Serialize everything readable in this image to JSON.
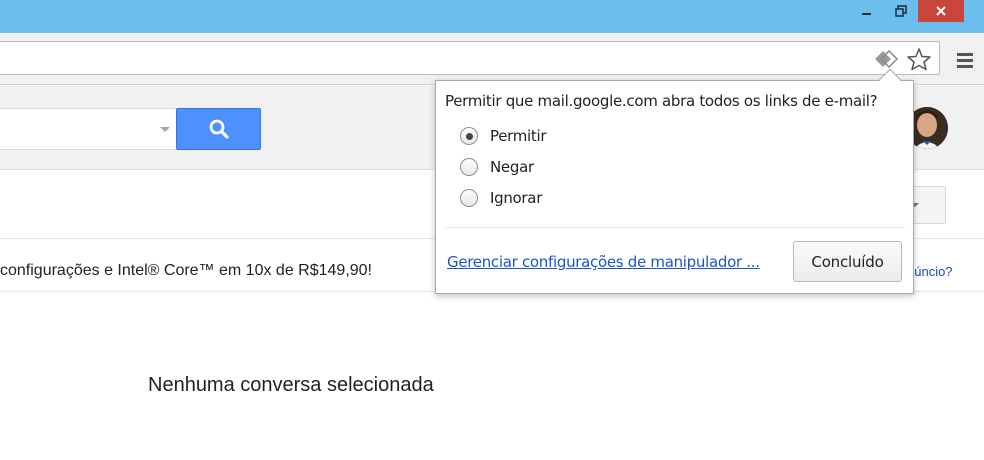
{
  "window": {
    "controls": {
      "minimize_icon": "minimize-icon",
      "maximize_icon": "restore-icon",
      "close_icon": "close-icon"
    },
    "titlebar_color": "#6cbfec",
    "close_color": "#c9463d"
  },
  "toolbar": {
    "icons": [
      "protocol-handler-icon",
      "bookmark-star-icon",
      "chrome-menu-icon"
    ]
  },
  "gmail": {
    "search_button_color": "#4d90fe",
    "search_icon": "search-icon",
    "ad": {
      "text": "configurações e Intel® Core™ em 10x de R$149,90!",
      "link": "núncio?"
    },
    "empty_state": "Nenhuma conversa selecionada"
  },
  "bubble": {
    "title": "Permitir que mail.google.com abra todos os links de e-mail?",
    "options": [
      {
        "label": "Permitir",
        "selected": true
      },
      {
        "label": "Negar",
        "selected": false
      },
      {
        "label": "Ignorar",
        "selected": false
      }
    ],
    "manage_link": "Gerenciar configurações de manipulador ...",
    "done_label": "Concluído"
  }
}
